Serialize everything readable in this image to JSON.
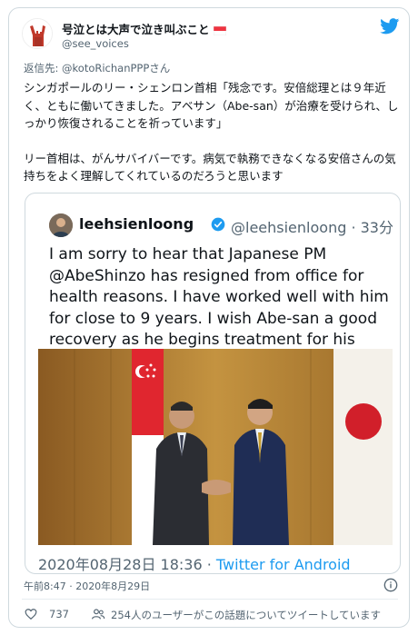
{
  "author": {
    "display_name": "号泣とは大声で泣き叫ぶこと",
    "handle": "@see_voices",
    "avatar_icon": "devil-horns-hand-icon",
    "flag_icon": "singapore-flag-icon"
  },
  "reply": {
    "prefix": "返信先: ",
    "target": "@kotoRichanPPPさん"
  },
  "tweet": {
    "paragraph1": "シンガポールのリー・シェンロン首相「残念です。安倍総理とは９年近く、ともに働いてきました。アベサン（Abe-san）が治療を受けられ、しっかり恢復されることを祈っています」",
    "paragraph2": "リー首相は、がんサバイバーです。病気で執務できなくなる安倍さんの気持ちをよく理解してくれているのだろうと思います"
  },
  "quoted": {
    "name": "leehsienloong",
    "handle_time": "@leehsienloong · 33分",
    "text": "I am sorry to hear that Japanese PM @AbeShinzo has resigned from office for health reasons. I have worked well with him for close to 9 years. I wish Abe-san a good recovery as he begins treatment for his condi...",
    "date": "2020年08月28日 18:36",
    "separator": " · ",
    "source": "Twitter for Android"
  },
  "meta": {
    "timestamp": "午前8:47 · 2020年8月29日",
    "likes": "737",
    "talking": "254人のユーザーがこの話題についてツイートしています"
  },
  "colors": {
    "link": "#1d9bf0",
    "secondary": "#536471",
    "border": "#cfd9de",
    "twitter_blue": "#1d9bf0"
  }
}
